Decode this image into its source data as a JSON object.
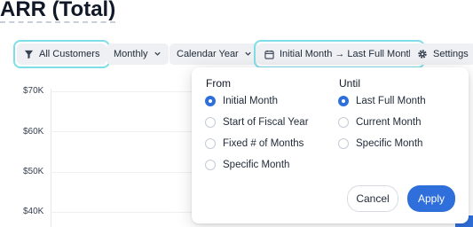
{
  "page": {
    "title": "ARR (Total)"
  },
  "toolbar": {
    "customers_label": "All Customers",
    "period_label": "Monthly",
    "calendar_label": "Calendar Year",
    "range_label": "Initial Month → Last Full Month",
    "settings_label": "Settings"
  },
  "chart": {
    "y_ticks": [
      "$70K",
      "$60K",
      "$50K",
      "$40K"
    ]
  },
  "popover": {
    "from_heading": "From",
    "until_heading": "Until",
    "from_options": [
      {
        "label": "Initial Month",
        "selected": true
      },
      {
        "label": "Start of Fiscal Year",
        "selected": false
      },
      {
        "label": "Fixed # of Months",
        "selected": false
      },
      {
        "label": "Specific Month",
        "selected": false
      }
    ],
    "until_options": [
      {
        "label": "Last Full Month",
        "selected": true
      },
      {
        "label": "Current Month",
        "selected": false
      },
      {
        "label": "Specific Month",
        "selected": false
      }
    ],
    "cancel_label": "Cancel",
    "apply_label": "Apply"
  },
  "colors": {
    "accent": "#2f6fdb",
    "highlight": "#7fdde8",
    "chart_line": "#f2b441"
  },
  "icons": {
    "customers": "filter-icon",
    "range": "calendar-icon",
    "settings": "gear-icon"
  }
}
